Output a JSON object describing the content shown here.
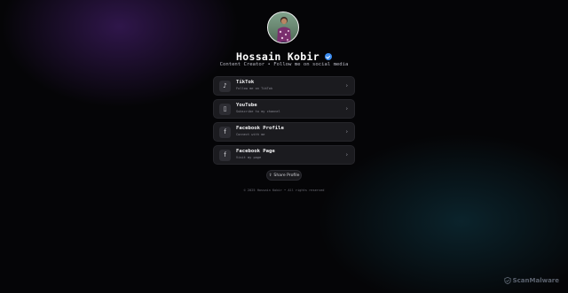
{
  "profile": {
    "name": "Hossain Kobir",
    "bio": "Content Creator • Follow me on social media"
  },
  "links": [
    {
      "title": "TikTok",
      "subtitle": "Follow me on TikTok",
      "icon": "tiktok-icon",
      "glyph": "♪"
    },
    {
      "title": "YouTube",
      "subtitle": "Subscribe to my channel",
      "icon": "youtube-icon",
      "glyph": "▯"
    },
    {
      "title": "Facebook Profile",
      "subtitle": "Connect with me",
      "icon": "facebook-icon",
      "glyph": "f"
    },
    {
      "title": "Facebook Page",
      "subtitle": "Visit my page",
      "icon": "facebook-icon",
      "glyph": "f"
    }
  ],
  "share": {
    "label": "Share Profile",
    "icon": "share-icon"
  },
  "footer": {
    "text": "© 2025 Hossain Kobir • All rights reserved"
  },
  "watermark": {
    "text": "ScanMalware"
  },
  "colors": {
    "background": "#050507",
    "card": "#1b1b1f",
    "verified": "#3d8ef2",
    "purple_glow": "#522482",
    "teal_glow": "#124858"
  }
}
